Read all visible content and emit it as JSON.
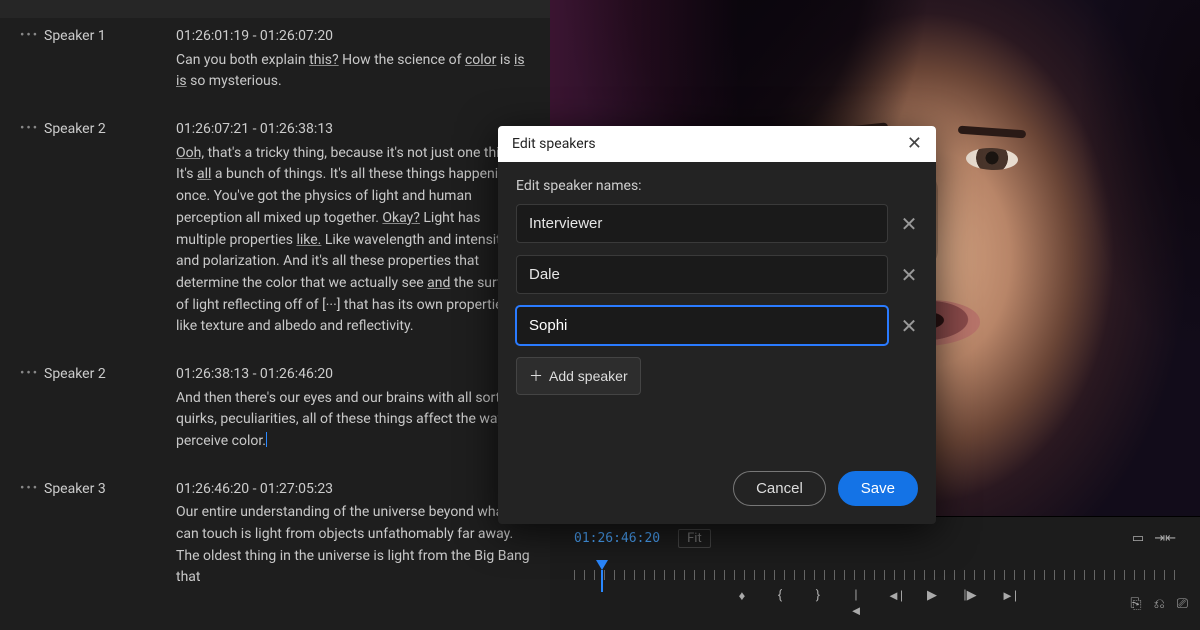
{
  "transcript": {
    "segments": [
      {
        "speaker": "Speaker 1",
        "timecode": "01:26:01:19 - 01:26:07:20",
        "text_html": "Can you both explain <span class='ul'>this?</span> How the science of <span class='ul'>color</span> is <span class='ul'>is is</span> so mysterious."
      },
      {
        "speaker": "Speaker 2",
        "timecode": "01:26:07:21 - 01:26:38:13",
        "text_html": "<span class='ul'>Ooh,</span> that's a tricky thing, because it's not just one thing. It's <span class='ul'>all</span> a bunch of things. It's all these things happening at once. You've got the physics of light and human perception all mixed up together. <span class='ul'>Okay?</span> Light has multiple properties <span class='ul'>like.</span> Like wavelength and intensity and polarization. And it's all these properties that determine the color that we actually see <span class='ul'>and</span> the surface of light reflecting off of [···] that has its own properties <span class='ul'>to</span> like texture and albedo and reflectivity."
      },
      {
        "speaker": "Speaker 2",
        "timecode": "01:26:38:13 - 01:26:46:20",
        "text_html": "And then there's our eyes and our brains with all sorts of quirks, peculiarities, all of these things affect the way we perceive color.<span class='cursor-caret'></span>"
      },
      {
        "speaker": "Speaker 3",
        "timecode": "01:26:46:20 - 01:27:05:23",
        "text_html": "Our entire understanding of the universe beyond what we can touch is light from objects unfathomably far away. The oldest thing in the universe is light from the Big Bang that"
      }
    ]
  },
  "modal": {
    "title": "Edit speakers",
    "label": "Edit speaker names:",
    "speakers": [
      "Interviewer",
      "Dale",
      "Sophi"
    ],
    "focused_index": 2,
    "add_label": "Add speaker",
    "cancel_label": "Cancel",
    "save_label": "Save"
  },
  "player": {
    "timecode": "01:26:46:20",
    "fit_label": "Fit"
  }
}
